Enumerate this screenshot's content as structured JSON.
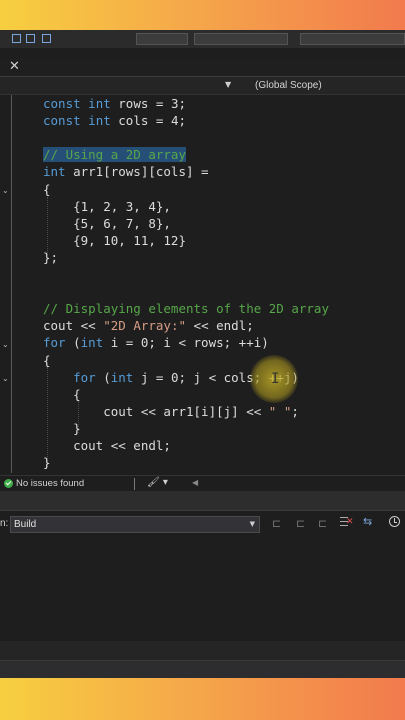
{
  "scope": {
    "label": "(Global Scope)"
  },
  "code": {
    "lines": [
      {
        "segments": [
          {
            "t": "const",
            "c": "kw"
          },
          {
            "t": " "
          },
          {
            "t": "int",
            "c": "kw"
          },
          {
            "t": " rows = 3;"
          }
        ]
      },
      {
        "segments": [
          {
            "t": "const",
            "c": "kw"
          },
          {
            "t": " "
          },
          {
            "t": "int",
            "c": "kw"
          },
          {
            "t": " cols = 4;"
          }
        ]
      },
      {
        "segments": []
      },
      {
        "segments": [
          {
            "t": "// Using a 2D array",
            "c": "cm sel"
          }
        ]
      },
      {
        "segments": [
          {
            "t": "int",
            "c": "kw"
          },
          {
            "t": " arr1[rows][cols] ="
          }
        ]
      },
      {
        "segments": [
          {
            "t": "{"
          }
        ]
      },
      {
        "segments": [
          {
            "t": "    {1, 2, 3, 4},"
          }
        ]
      },
      {
        "segments": [
          {
            "t": "    {5, 6, 7, 8},"
          }
        ]
      },
      {
        "segments": [
          {
            "t": "    {9, 10, 11, 12}"
          }
        ]
      },
      {
        "segments": [
          {
            "t": "};"
          }
        ]
      },
      {
        "segments": []
      },
      {
        "segments": []
      },
      {
        "segments": [
          {
            "t": "// Displaying elements of the 2D array",
            "c": "cm"
          }
        ]
      },
      {
        "segments": [
          {
            "t": "cout << "
          },
          {
            "t": "\"2D Array:\"",
            "c": "st"
          },
          {
            "t": " << endl;"
          }
        ]
      },
      {
        "segments": [
          {
            "t": "for",
            "c": "kw"
          },
          {
            "t": " ("
          },
          {
            "t": "int",
            "c": "kw"
          },
          {
            "t": " i = 0; i < rows; ++i)"
          }
        ]
      },
      {
        "segments": [
          {
            "t": "{"
          }
        ]
      },
      {
        "segments": [
          {
            "t": "    "
          },
          {
            "t": "for",
            "c": "kw"
          },
          {
            "t": " ("
          },
          {
            "t": "int",
            "c": "kw"
          },
          {
            "t": " j = 0; j < cols; ++j)"
          }
        ]
      },
      {
        "segments": [
          {
            "t": "    {"
          }
        ]
      },
      {
        "segments": [
          {
            "t": "        cout << arr1[i][j] << "
          },
          {
            "t": "\" \"",
            "c": "st"
          },
          {
            "t": ";"
          }
        ]
      },
      {
        "segments": [
          {
            "t": "    }"
          }
        ]
      },
      {
        "segments": [
          {
            "t": "    cout << endl;"
          }
        ]
      },
      {
        "segments": [
          {
            "t": "}"
          }
        ]
      }
    ]
  },
  "status": {
    "message": "No issues found"
  },
  "output": {
    "show_label": "n:",
    "source": "Build"
  }
}
